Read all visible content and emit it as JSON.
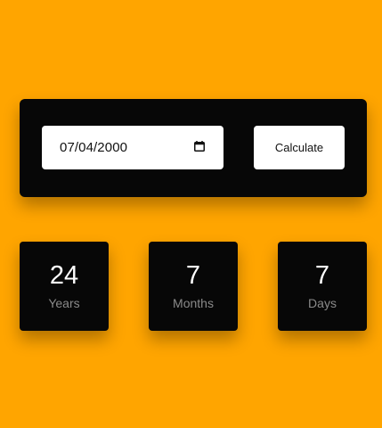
{
  "page": {
    "background_color": "#ffa500",
    "panel_color": "#070707"
  },
  "date_input": {
    "value": "07/04/2000",
    "icon": "calendar-icon"
  },
  "calculate_button": {
    "label": "Calculate"
  },
  "results": {
    "years": {
      "value": "24",
      "label": "Years"
    },
    "months": {
      "value": "7",
      "label": "Months"
    },
    "days": {
      "value": "7",
      "label": "Days"
    }
  }
}
